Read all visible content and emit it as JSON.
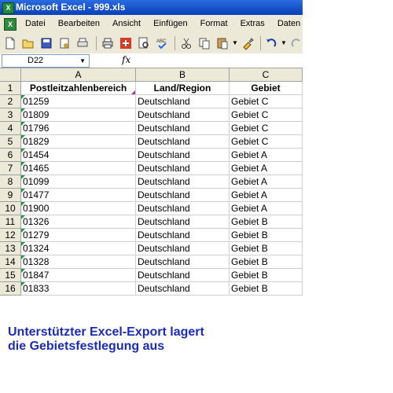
{
  "window": {
    "title": "Microsoft Excel - 999.xls",
    "app_icon": "excel-app-icon"
  },
  "menu": {
    "items": [
      "Datei",
      "Bearbeiten",
      "Ansicht",
      "Einfügen",
      "Format",
      "Extras",
      "Daten"
    ]
  },
  "toolbar": {
    "buttons": [
      "new-icon",
      "open-icon",
      "save-icon",
      "permission-icon",
      "print-preview-icon",
      "print-icon",
      "research-icon",
      "preview-icon",
      "spellcheck-icon",
      "cut-icon",
      "copy-icon",
      "paste-icon",
      "format-painter-icon",
      "undo-icon",
      "redo-icon"
    ]
  },
  "formula_bar": {
    "cell_ref": "D22",
    "fx": "fx",
    "value": ""
  },
  "sheet": {
    "columns": [
      "A",
      "B",
      "C"
    ],
    "rows": [
      {
        "n": "1",
        "a": "Postleitzahlenbereich",
        "b": "Land/Region",
        "c": "Gebiet"
      },
      {
        "n": "2",
        "a": "01259",
        "b": "Deutschland",
        "c": "Gebiet C"
      },
      {
        "n": "3",
        "a": "01809",
        "b": "Deutschland",
        "c": "Gebiet C"
      },
      {
        "n": "4",
        "a": "01796",
        "b": "Deutschland",
        "c": "Gebiet C"
      },
      {
        "n": "5",
        "a": "01829",
        "b": "Deutschland",
        "c": "Gebiet C"
      },
      {
        "n": "6",
        "a": "01454",
        "b": "Deutschland",
        "c": "Gebiet A"
      },
      {
        "n": "7",
        "a": "01465",
        "b": "Deutschland",
        "c": "Gebiet A"
      },
      {
        "n": "8",
        "a": "01099",
        "b": "Deutschland",
        "c": "Gebiet A"
      },
      {
        "n": "9",
        "a": "01477",
        "b": "Deutschland",
        "c": "Gebiet A"
      },
      {
        "n": "10",
        "a": "01900",
        "b": "Deutschland",
        "c": "Gebiet A"
      },
      {
        "n": "11",
        "a": "01326",
        "b": "Deutschland",
        "c": "Gebiet B"
      },
      {
        "n": "12",
        "a": "01279",
        "b": "Deutschland",
        "c": "Gebiet B"
      },
      {
        "n": "13",
        "a": "01324",
        "b": "Deutschland",
        "c": "Gebiet B"
      },
      {
        "n": "14",
        "a": "01328",
        "b": "Deutschland",
        "c": "Gebiet B"
      },
      {
        "n": "15",
        "a": "01847",
        "b": "Deutschland",
        "c": "Gebiet B"
      },
      {
        "n": "16",
        "a": "01833",
        "b": "Deutschland",
        "c": "Gebiet B"
      }
    ]
  },
  "caption": {
    "line1": "Unterstützter Excel-Export lagert",
    "line2": "die Gebietsfestlegung aus"
  },
  "colors": {
    "title_bar": "#0a3fb8",
    "chrome": "#ece9d8",
    "caption": "#1c2bb8",
    "text_marker": "#1f9a3a"
  }
}
